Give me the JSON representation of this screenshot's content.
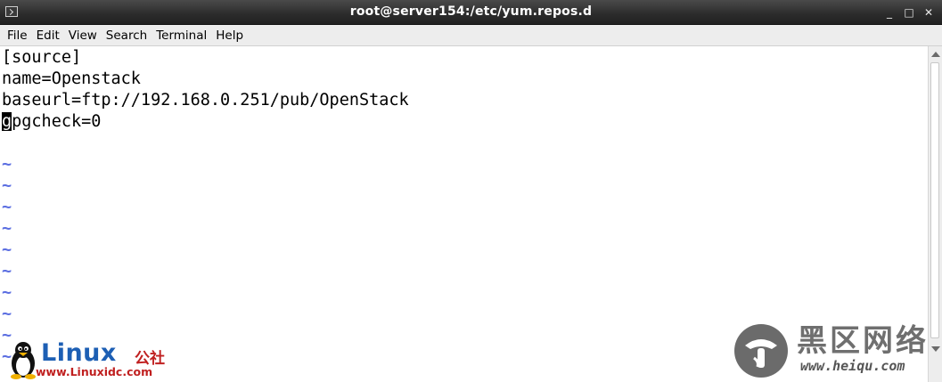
{
  "window": {
    "title": "root@server154:/etc/yum.repos.d",
    "controls": [
      "_",
      "□",
      "✕"
    ]
  },
  "menu": {
    "items": [
      "File",
      "Edit",
      "View",
      "Search",
      "Terminal",
      "Help"
    ]
  },
  "editor": {
    "lines": [
      "[source]",
      "name=Openstack",
      "baseurl=ftp://192.168.0.251/pub/OpenStack"
    ],
    "cursor_line": {
      "cursor_char": "g",
      "rest": "pgcheck=0"
    },
    "empty_line_marker": "~",
    "tilde_color": "#5b6ee1"
  },
  "watermarks": {
    "left": {
      "brand": "Linux",
      "brand_cn": "公社",
      "url": "www.Linuxidc.com"
    },
    "right": {
      "brand_cn": "黑区网络",
      "url": "www.heiqu.com"
    }
  },
  "colors": {
    "titlebar": "#2b2b2b",
    "menubar": "#ededed",
    "text": "#000000",
    "linux_blue": "#1d5fb4",
    "linux_red": "#c02020"
  }
}
